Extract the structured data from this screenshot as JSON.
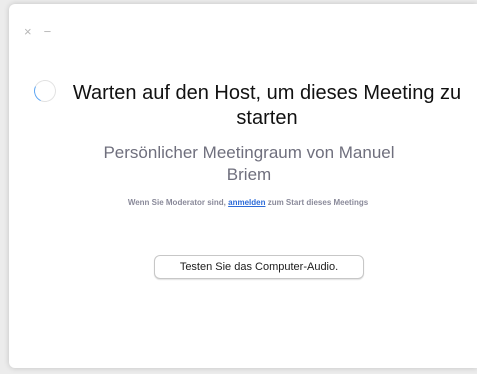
{
  "window_controls": {
    "close_glyph": "×",
    "minimize_glyph": "−"
  },
  "main": {
    "title": "Warten auf den Host, um dieses Meeting zu starten",
    "subtitle": "Persönlicher Meetingraum von Manuel Briem",
    "moderator_note": {
      "prefix": "Wenn Sie Moderator sind, ",
      "link_label": "anmelden",
      "suffix": " zum Start dieses Meetings"
    },
    "test_audio_button": "Testen Sie das Computer-Audio."
  },
  "colors": {
    "link": "#2d6bd8",
    "spinner_accent": "#5aa4f2",
    "subtitle": "#6f6f7d"
  },
  "icons": {
    "spinner": "loading-spinner-icon",
    "close": "close-icon",
    "minimize": "minimize-icon"
  }
}
